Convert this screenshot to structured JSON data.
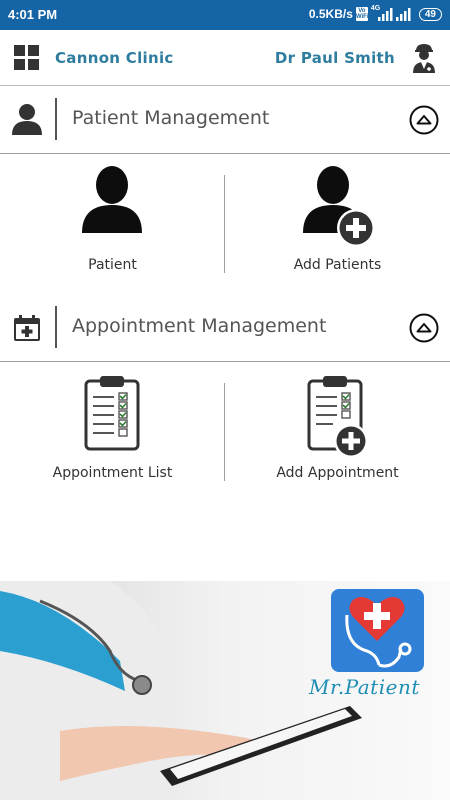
{
  "status_bar": {
    "time": "4:01 PM",
    "network_speed": "0.5KB/s",
    "vowifi_top": "Vo",
    "vowifi_bottom": "WiFi",
    "net_top": "4G",
    "battery": "49"
  },
  "app_bar": {
    "clinic_name": "Cannon Clinic",
    "doctor_name": "Dr Paul Smith"
  },
  "patient_section": {
    "title": "Patient Management",
    "tiles": [
      {
        "label": "Patient",
        "icon": "person-icon"
      },
      {
        "label": "Add Patients",
        "icon": "add-person-icon"
      }
    ]
  },
  "appointment_section": {
    "title": "Appointment Management",
    "tiles": [
      {
        "label": "Appointment List",
        "icon": "clipboard-icon"
      },
      {
        "label": "Add Appointment",
        "icon": "add-clipboard-icon"
      }
    ]
  },
  "banner": {
    "brand": "Mr.Patient"
  },
  "colors": {
    "status_bar": "#1565a6",
    "accent_text": "#2e7d9f",
    "brand_text": "#1f8fb5",
    "logo_bg": "#2f80d6",
    "heart": "#e53935"
  }
}
